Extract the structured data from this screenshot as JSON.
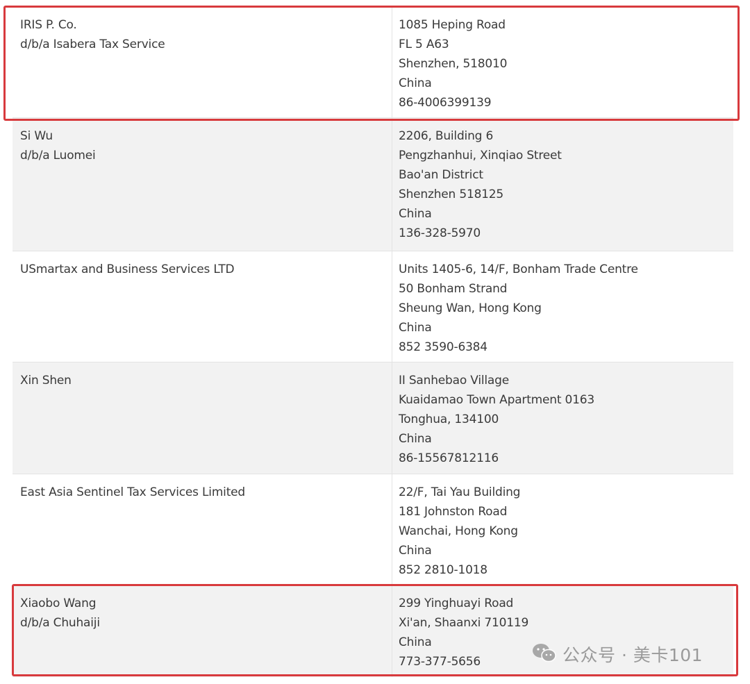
{
  "rows": [
    {
      "name_lines": [
        "IRIS P. Co.",
        "d/b/a Isabera Tax Service"
      ],
      "address_lines": [
        "1085 Heping Road",
        "FL 5 A63",
        "Shenzhen, 518010",
        "China",
        "86-4006399139"
      ],
      "highlighted": true
    },
    {
      "name_lines": [
        "Si Wu",
        "d/b/a Luomei"
      ],
      "address_lines": [
        "2206, Building 6",
        "Pengzhanhui, Xinqiao Street",
        "Bao'an District",
        "Shenzhen 518125",
        "China",
        "136-328-5970"
      ],
      "highlighted": false
    },
    {
      "name_lines": [
        "USmartax and Business Services LTD"
      ],
      "address_lines": [
        "Units 1405-6, 14/F, Bonham Trade Centre",
        "50 Bonham Strand",
        "Sheung Wan, Hong Kong",
        "China",
        "852 3590-6384"
      ],
      "highlighted": false
    },
    {
      "name_lines": [
        "Xin Shen"
      ],
      "address_lines": [
        "II Sanhebao Village",
        "Kuaidamao Town Apartment 0163",
        "Tonghua, 134100",
        "China",
        "86-15567812116"
      ],
      "highlighted": false
    },
    {
      "name_lines": [
        "East Asia Sentinel Tax Services Limited"
      ],
      "address_lines": [
        "22/F, Tai Yau Building",
        "181 Johnston Road",
        "Wanchai, Hong Kong",
        "China",
        "852 2810-1018"
      ],
      "highlighted": false
    },
    {
      "name_lines": [
        "Xiaobo Wang",
        "d/b/a Chuhaiji"
      ],
      "address_lines": [
        "299 Yinghuayi Road",
        "Xi'an, Shaanxi 710119",
        "China",
        "773-377-5656"
      ],
      "highlighted": true
    }
  ],
  "watermark": {
    "icon": "wechat-icon",
    "text": "公众号 · 美卡101"
  },
  "colors": {
    "highlight": "#d83a3d",
    "shaded_row": "#f2f2f2",
    "text": "#3a3a3a",
    "watermark": "#9a9a9a"
  }
}
